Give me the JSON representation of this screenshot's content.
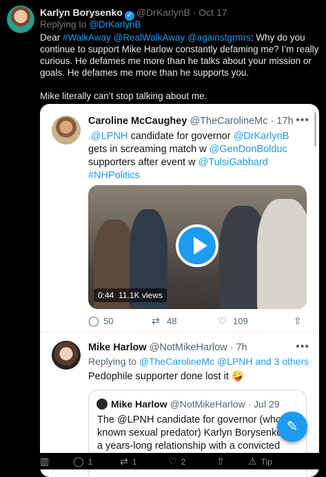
{
  "tweet": {
    "author_name": "Karlyn Borysenko",
    "handle": "@DrKarlynB",
    "date": "Oct 17",
    "replying_label": "Replying to",
    "replying_to": "@DrKarlynB",
    "text_prefix": "Dear ",
    "mentions": [
      "#WalkAway",
      "@RealWalkAway",
      "@againstgrmrs"
    ],
    "text_main": ": Why do you continue to support Mike Harlow constantly defaming me? I’m really curious. He defames me more than he talks about your mission or goals. He defames me more than he supports you.",
    "text_second": "Mike literally can’t stop talking about me."
  },
  "embed_tweet": {
    "author_name": "Caroline McCaughey",
    "handle": "@TheCarolineMc",
    "time": "17h",
    "seg1": ".@LPNH",
    "seg2": " candidate for governor ",
    "seg3": "@DrKarlynB",
    "seg4": " gets in screaming match w ",
    "seg5": "@GenDonBolduc",
    "seg6": " supporters after event w ",
    "seg7": "@TulsiGabbard",
    "seg8": "#NHPolitics",
    "video_duration": "0:44",
    "video_views": "11.1K views",
    "replies": "50",
    "retweets": "48",
    "likes": "109"
  },
  "reply_tweet": {
    "author_name": "Mike Harlow",
    "handle": "@NotMikeHarlow",
    "time": "7h",
    "replying_label": "Replying to",
    "replying_to": "@TheCarolineMc @LPNH and 3 others",
    "text": "Pedophile supporter done lost it 🤪"
  },
  "quote_tweet": {
    "author_name": "Mike Harlow",
    "handle": "@NotMikeHarlow",
    "date": "Jul 29",
    "text": "The @LPNH candidate for governor (who is a known sexual predator) Karlyn Borysenko c on a years-long relationship with a convicted"
  },
  "bottom_bar": {
    "replies": "1",
    "retweets": "1",
    "likes": "2",
    "tip_label": "Tip"
  },
  "colors": {
    "accent": "#1d9bf0",
    "background": "#000000",
    "card": "#ffffff"
  },
  "icons": [
    "verified-icon",
    "more-icon",
    "play-icon",
    "reply-icon",
    "retweet-icon",
    "like-icon",
    "share-icon",
    "analytics-icon",
    "tip-icon",
    "compose-icon"
  ]
}
